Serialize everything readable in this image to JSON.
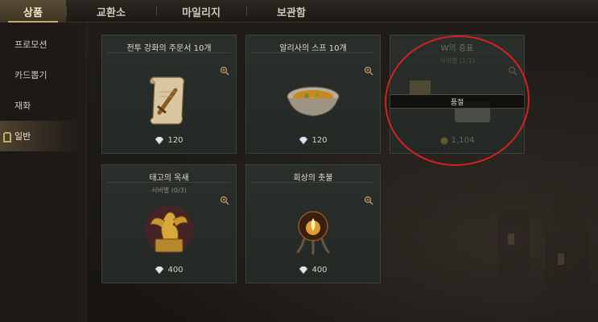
{
  "tabs": [
    {
      "label": "상품",
      "active": true
    },
    {
      "label": "교환소",
      "active": false
    },
    {
      "label": "마일리지",
      "active": false
    },
    {
      "label": "보관함",
      "active": false
    }
  ],
  "sidebar": {
    "items": [
      {
        "label": "프로모션",
        "active": false
      },
      {
        "label": "카드뽑기",
        "active": false
      },
      {
        "label": "재화",
        "active": false
      },
      {
        "label": "일반",
        "active": true
      }
    ]
  },
  "cards": [
    {
      "title": "전투 강화의 주문서 10개",
      "subtitle": "",
      "price": "120",
      "currency_icon": "crystal-icon",
      "soldout": false
    },
    {
      "title": "알리사의 스프 10개",
      "subtitle": "",
      "price": "120",
      "currency_icon": "crystal-icon",
      "soldout": false
    },
    {
      "title": "W의 증표",
      "subtitle": "서버별 (1/1)",
      "price": "1,104",
      "currency_icon": "coin-icon",
      "soldout": true,
      "soldout_label": "품절"
    },
    {
      "title": "태고의 옥새",
      "subtitle": "서버별 (0/3)",
      "price": "400",
      "currency_icon": "crystal-icon",
      "soldout": false
    },
    {
      "title": "회상의 촛불",
      "subtitle": "",
      "price": "400",
      "currency_icon": "crystal-icon",
      "soldout": false
    }
  ],
  "colors": {
    "accent": "#c9a86a",
    "annotation": "#d62020"
  }
}
